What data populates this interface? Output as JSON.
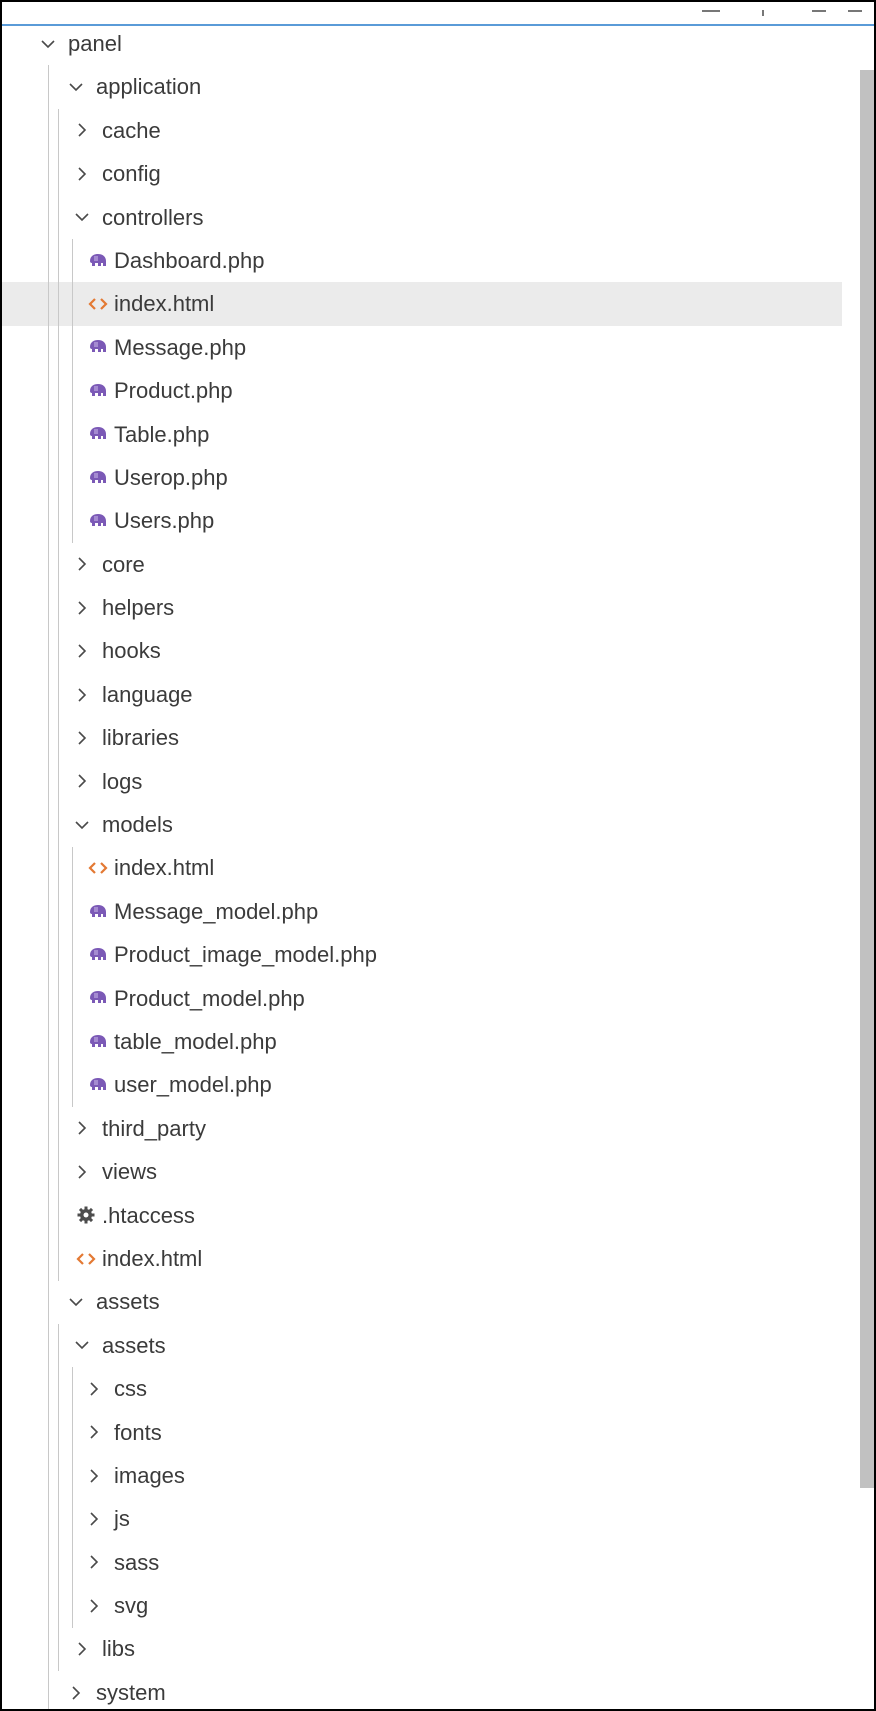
{
  "tree": [
    {
      "label": "panel",
      "type": "folder",
      "expanded": true,
      "depth": 0
    },
    {
      "label": "application",
      "type": "folder",
      "expanded": true,
      "depth": 1
    },
    {
      "label": "cache",
      "type": "folder",
      "expanded": false,
      "depth": 2
    },
    {
      "label": "config",
      "type": "folder",
      "expanded": false,
      "depth": 2
    },
    {
      "label": "controllers",
      "type": "folder",
      "expanded": true,
      "depth": 2
    },
    {
      "label": "Dashboard.php",
      "type": "php",
      "depth": 3
    },
    {
      "label": "index.html",
      "type": "html",
      "depth": 3,
      "selected": true
    },
    {
      "label": "Message.php",
      "type": "php",
      "depth": 3
    },
    {
      "label": "Product.php",
      "type": "php",
      "depth": 3
    },
    {
      "label": "Table.php",
      "type": "php",
      "depth": 3
    },
    {
      "label": "Userop.php",
      "type": "php",
      "depth": 3
    },
    {
      "label": "Users.php",
      "type": "php",
      "depth": 3
    },
    {
      "label": "core",
      "type": "folder",
      "expanded": false,
      "depth": 2
    },
    {
      "label": "helpers",
      "type": "folder",
      "expanded": false,
      "depth": 2
    },
    {
      "label": "hooks",
      "type": "folder",
      "expanded": false,
      "depth": 2
    },
    {
      "label": "language",
      "type": "folder",
      "expanded": false,
      "depth": 2
    },
    {
      "label": "libraries",
      "type": "folder",
      "expanded": false,
      "depth": 2
    },
    {
      "label": "logs",
      "type": "folder",
      "expanded": false,
      "depth": 2
    },
    {
      "label": "models",
      "type": "folder",
      "expanded": true,
      "depth": 2
    },
    {
      "label": "index.html",
      "type": "html",
      "depth": 3
    },
    {
      "label": "Message_model.php",
      "type": "php",
      "depth": 3
    },
    {
      "label": "Product_image_model.php",
      "type": "php",
      "depth": 3
    },
    {
      "label": "Product_model.php",
      "type": "php",
      "depth": 3
    },
    {
      "label": "table_model.php",
      "type": "php",
      "depth": 3
    },
    {
      "label": "user_model.php",
      "type": "php",
      "depth": 3
    },
    {
      "label": "third_party",
      "type": "folder",
      "expanded": false,
      "depth": 2
    },
    {
      "label": "views",
      "type": "folder",
      "expanded": false,
      "depth": 2
    },
    {
      "label": ".htaccess",
      "type": "config",
      "depth": 2
    },
    {
      "label": "index.html",
      "type": "html",
      "depth": 2
    },
    {
      "label": "assets",
      "type": "folder",
      "expanded": true,
      "depth": 1
    },
    {
      "label": "assets",
      "type": "folder",
      "expanded": true,
      "depth": 2
    },
    {
      "label": "css",
      "type": "folder",
      "expanded": false,
      "depth": 3
    },
    {
      "label": "fonts",
      "type": "folder",
      "expanded": false,
      "depth": 3
    },
    {
      "label": "images",
      "type": "folder",
      "expanded": false,
      "depth": 3
    },
    {
      "label": "js",
      "type": "folder",
      "expanded": false,
      "depth": 3
    },
    {
      "label": "sass",
      "type": "folder",
      "expanded": false,
      "depth": 3
    },
    {
      "label": "svg",
      "type": "folder",
      "expanded": false,
      "depth": 3
    },
    {
      "label": "libs",
      "type": "folder",
      "expanded": false,
      "depth": 2
    },
    {
      "label": "system",
      "type": "folder",
      "expanded": false,
      "depth": 1
    }
  ],
  "colors": {
    "php_icon": "#7b59b6",
    "html_icon": "#e37933",
    "config_icon": "#4d4d4d",
    "text": "#3b3b3b",
    "chevron": "#4a4a4a",
    "selected_row": "#ebebeb",
    "guide": "#c8c8c8",
    "scrollbar": "#c1c1c1",
    "top_accent": "#5a9bd8"
  }
}
